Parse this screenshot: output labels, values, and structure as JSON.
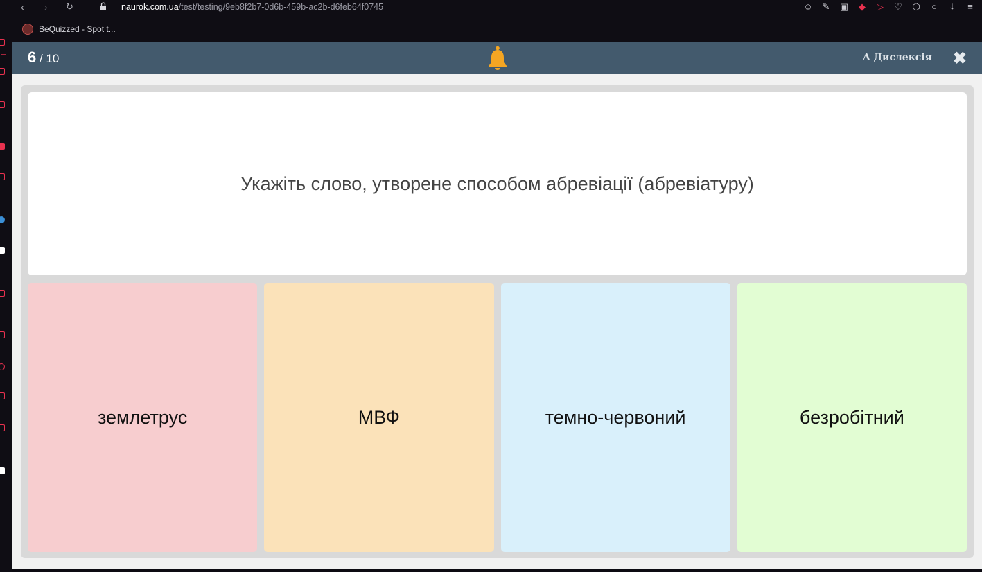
{
  "browser": {
    "url_host": "naurok.com.ua",
    "url_path": "/test/testing/9eb8f2b7-0d6b-459b-ac2b-d6feb64f0745",
    "bookmark_label": "BeQuizzed - Spot t..."
  },
  "header": {
    "current": "6",
    "total": "/ 10",
    "dyslexia_label": "A Дислексія",
    "close_label": "✖"
  },
  "question": {
    "text": "Укажіть слово, утворене способом абревіації (абревіатуру)"
  },
  "answers": [
    {
      "label": "землетрус",
      "color": "#f7cdcf"
    },
    {
      "label": "МВФ",
      "color": "#fbe2b9"
    },
    {
      "label": "темно-червоний",
      "color": "#d9f0fb"
    },
    {
      "label": "безробітний",
      "color": "#e2fdd3"
    }
  ],
  "colors": {
    "header_bg": "#435a6d",
    "bell": "#f5a623",
    "accent_red": "#e8314f"
  }
}
